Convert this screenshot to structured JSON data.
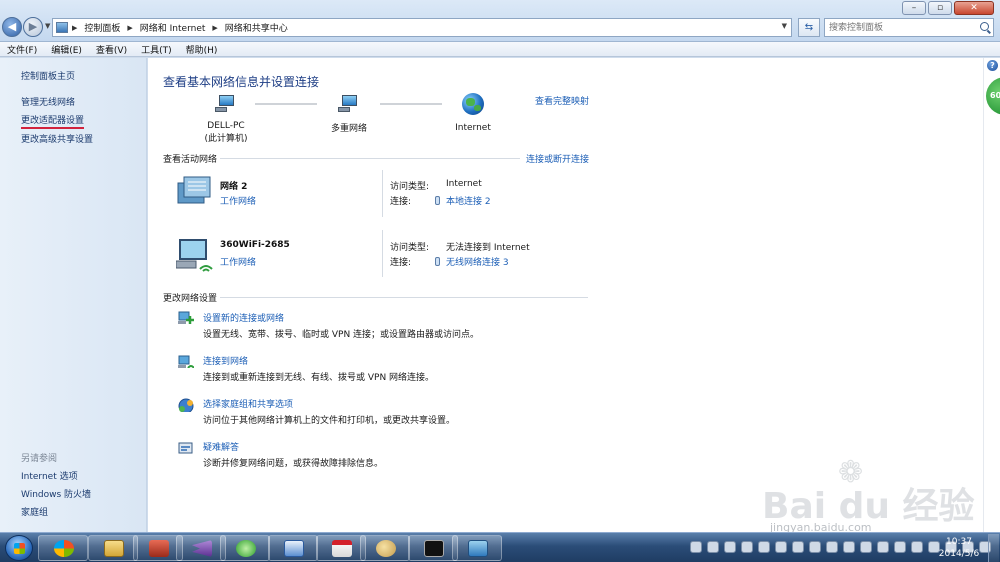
{
  "window": {
    "breadcrumb": [
      "控制面板",
      "网络和 Internet",
      "网络和共享中心"
    ],
    "search_placeholder": "搜索控制面板"
  },
  "menu": [
    "文件(F)",
    "编辑(E)",
    "查看(V)",
    "工具(T)",
    "帮助(H)"
  ],
  "sidebar": {
    "home": "控制面板主页",
    "links": [
      "管理无线网络",
      "更改适配器设置",
      "更改高级共享设置"
    ],
    "see_also_title": "另请参阅",
    "see_also": [
      "Internet 选项",
      "Windows 防火墙",
      "家庭组"
    ]
  },
  "main": {
    "title": "查看基本网络信息并设置连接",
    "full_map_link": "查看完整映射",
    "nodes": [
      {
        "line1": "DELL-PC",
        "line2": "(此计算机)"
      },
      {
        "line1": "多重网络",
        "line2": ""
      },
      {
        "line1": "Internet",
        "line2": ""
      }
    ],
    "active_header": "查看活动网络",
    "connect_link": "连接或断开连接",
    "networks": [
      {
        "name": "网络  2",
        "type": "工作网络",
        "access_label": "访问类型:",
        "access_value": "Internet",
        "conn_label": "连接:",
        "conn_value": "本地连接 2"
      },
      {
        "name": "360WiFi-2685",
        "type": "工作网络",
        "access_label": "访问类型:",
        "access_value": "无法连接到 Internet",
        "conn_label": "连接:",
        "conn_value": "无线网络连接 3"
      }
    ],
    "change_header": "更改网络设置",
    "tasks": [
      {
        "title": "设置新的连接或网络",
        "desc": "设置无线、宽带、拨号、临时或 VPN 连接；或设置路由器或访问点。"
      },
      {
        "title": "连接到网络",
        "desc": "连接到或重新连接到无线、有线、拨号或 VPN 网络连接。"
      },
      {
        "title": "选择家庭组和共享选项",
        "desc": "访问位于其他网络计算机上的文件和打印机，或更改共享设置。"
      },
      {
        "title": "疑难解答",
        "desc": "诊断并修复网络问题，或获得故障排除信息。"
      }
    ]
  },
  "badge": "60",
  "watermark": {
    "text": "Bai du 经验",
    "sub": "jingyan.baidu.com"
  },
  "taskbar": {
    "time": "10:37",
    "date": "2014/5/6"
  }
}
